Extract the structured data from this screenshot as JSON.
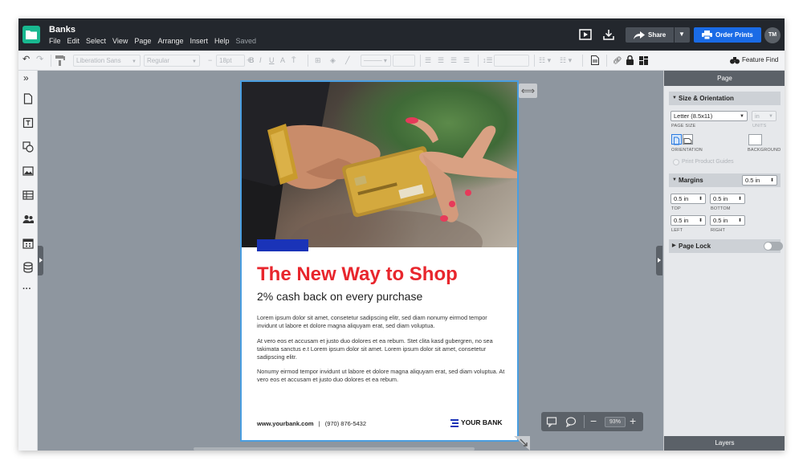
{
  "app": {
    "title": "Banks",
    "saved_status": "Saved"
  },
  "menu": [
    "File",
    "Edit",
    "Select",
    "View",
    "Page",
    "Arrange",
    "Insert",
    "Help"
  ],
  "header": {
    "share_label": "Share",
    "order_label": "Order Prints",
    "avatar_initials": "TM"
  },
  "toolbar": {
    "font": "Liberation Sans",
    "weight": "Regular",
    "font_size": "18pt",
    "feature_find": "Feature Find"
  },
  "canvas": {
    "headline": "The New Way to Shop",
    "subhead": "2% cash back on every purchase",
    "paragraphs": [
      "Lorem ipsum dolor sit amet, consetetur sadipscing elitr, sed diam nonumy eirmod tempor invidunt ut labore et dolore magna aliquyam erat, sed diam voluptua.",
      "At vero eos et accusam et justo duo dolores et ea rebum. Stet clita kasd gubergren, no sea takimata sanctus e.t Lorem ipsum dolor sit amet. Lorem ipsum dolor sit amet, consetetur sadipscing elitr.",
      "Nonumy eirmod tempor invidunt ut labore et dolore magna aliquyam erat, sed diam voluptua. At vero eos et accusam et justo duo dolores et ea rebum."
    ],
    "footer_url": "www.yourbank.com",
    "footer_phone": "(970) 876-5432",
    "brand": "YOUR BANK",
    "accent_red": "#e8262d",
    "accent_blue": "#1a33b8"
  },
  "zoom": {
    "value": "93%"
  },
  "panel": {
    "title": "Page",
    "size_section": "Size & Orientation",
    "page_size": "Letter (8.5x11)",
    "page_size_label": "PAGE SIZE",
    "units_value": "in",
    "units_label": "UNITS",
    "orientation_label": "ORIENTATION",
    "background_label": "BACKGROUND",
    "print_guides": "Print Product Guides",
    "margins_section": "Margins",
    "margins_all": "0.5 in",
    "top": "0.5 in",
    "top_label": "TOP",
    "bottom": "0.5 in",
    "bottom_label": "BOTTOM",
    "left": "0.5 in",
    "left_label": "LEFT",
    "right": "0.5 in",
    "right_label": "RIGHT",
    "page_lock": "Page Lock",
    "layers": "Layers"
  }
}
